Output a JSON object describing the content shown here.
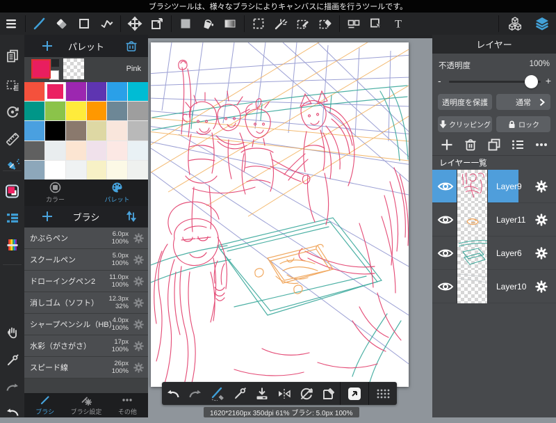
{
  "top_message": "ブラシツールは、様々なブラシによりキャンバスに描画を行うツールです。",
  "palette": {
    "title": "パレット",
    "current_color_name": "Pink",
    "current_color": "#e91e5f",
    "colors": [
      "#f4513c",
      "#eb2162",
      "#9c27b0",
      "#5e35b1",
      "#2aa0e8",
      "#00bcd4",
      "#009688",
      "#8bc34a",
      "#ffeb3b",
      "#ff9800",
      "#6d8796",
      "#9e9e9e",
      "#4aa0e0",
      "#000000",
      "#8a796d",
      "#ded8a4",
      "#f9e6dc",
      "#b9b9b9",
      "#606060",
      "#e9edef",
      "#fce5d2",
      "#f0e1eb",
      "#fce8e4",
      "#e9f1f5",
      "#8da7ba",
      "#ffffff",
      "#eff2f3",
      "#f7f1c6",
      "#fcf9e6",
      "#eff1ef"
    ],
    "selected_index": 1,
    "tabs": [
      {
        "label": "カラー"
      },
      {
        "label": "パレット"
      }
    ]
  },
  "brushes": {
    "title": "ブラシ",
    "items": [
      {
        "name": "かぶらペン",
        "size": "6.0px",
        "opacity": "100%"
      },
      {
        "name": "スクールペン",
        "size": "5.0px",
        "opacity": "100%"
      },
      {
        "name": "ドローイングペン2",
        "size": "11.0px",
        "opacity": "100%"
      },
      {
        "name": "消しゴム（ソフト）",
        "size": "12.3px",
        "opacity": "32%"
      },
      {
        "name": "シャープペンシル（HB）",
        "size": "4.0px",
        "opacity": "100%"
      },
      {
        "name": "水彩（がさがさ）",
        "size": "17px",
        "opacity": "100%"
      },
      {
        "name": "スピード線",
        "size": "26px",
        "opacity": "100%"
      }
    ],
    "tabs": [
      {
        "label": "ブラシ"
      },
      {
        "label": "ブラシ設定"
      },
      {
        "label": "その他"
      }
    ]
  },
  "layers_panel": {
    "title": "レイヤー",
    "opacity_label": "不透明度",
    "opacity_value": "100%",
    "minus": "-",
    "plus": "+",
    "protect_alpha_label": "透明度を保護",
    "blend_label": "通常",
    "clipping_label": "クリッピング",
    "lock_label": "ロック",
    "list_header": "レイヤー一覧",
    "layers": [
      {
        "name": "Layer9",
        "selected": true
      },
      {
        "name": "Layer11",
        "selected": false
      },
      {
        "name": "Layer6",
        "selected": false
      },
      {
        "name": "Layer10",
        "selected": false
      }
    ]
  },
  "status_bar": "1620*2160px 350dpi 61% ブラシ: 5.0px 100%",
  "colors": {
    "accent_blue": "#46a2dc",
    "selected_layer": "#4f9edb",
    "sketch_pink": "#e23a69",
    "sketch_teal": "#2da395",
    "sketch_orange": "#f0a050",
    "sketch_violet": "#7a80c6"
  }
}
